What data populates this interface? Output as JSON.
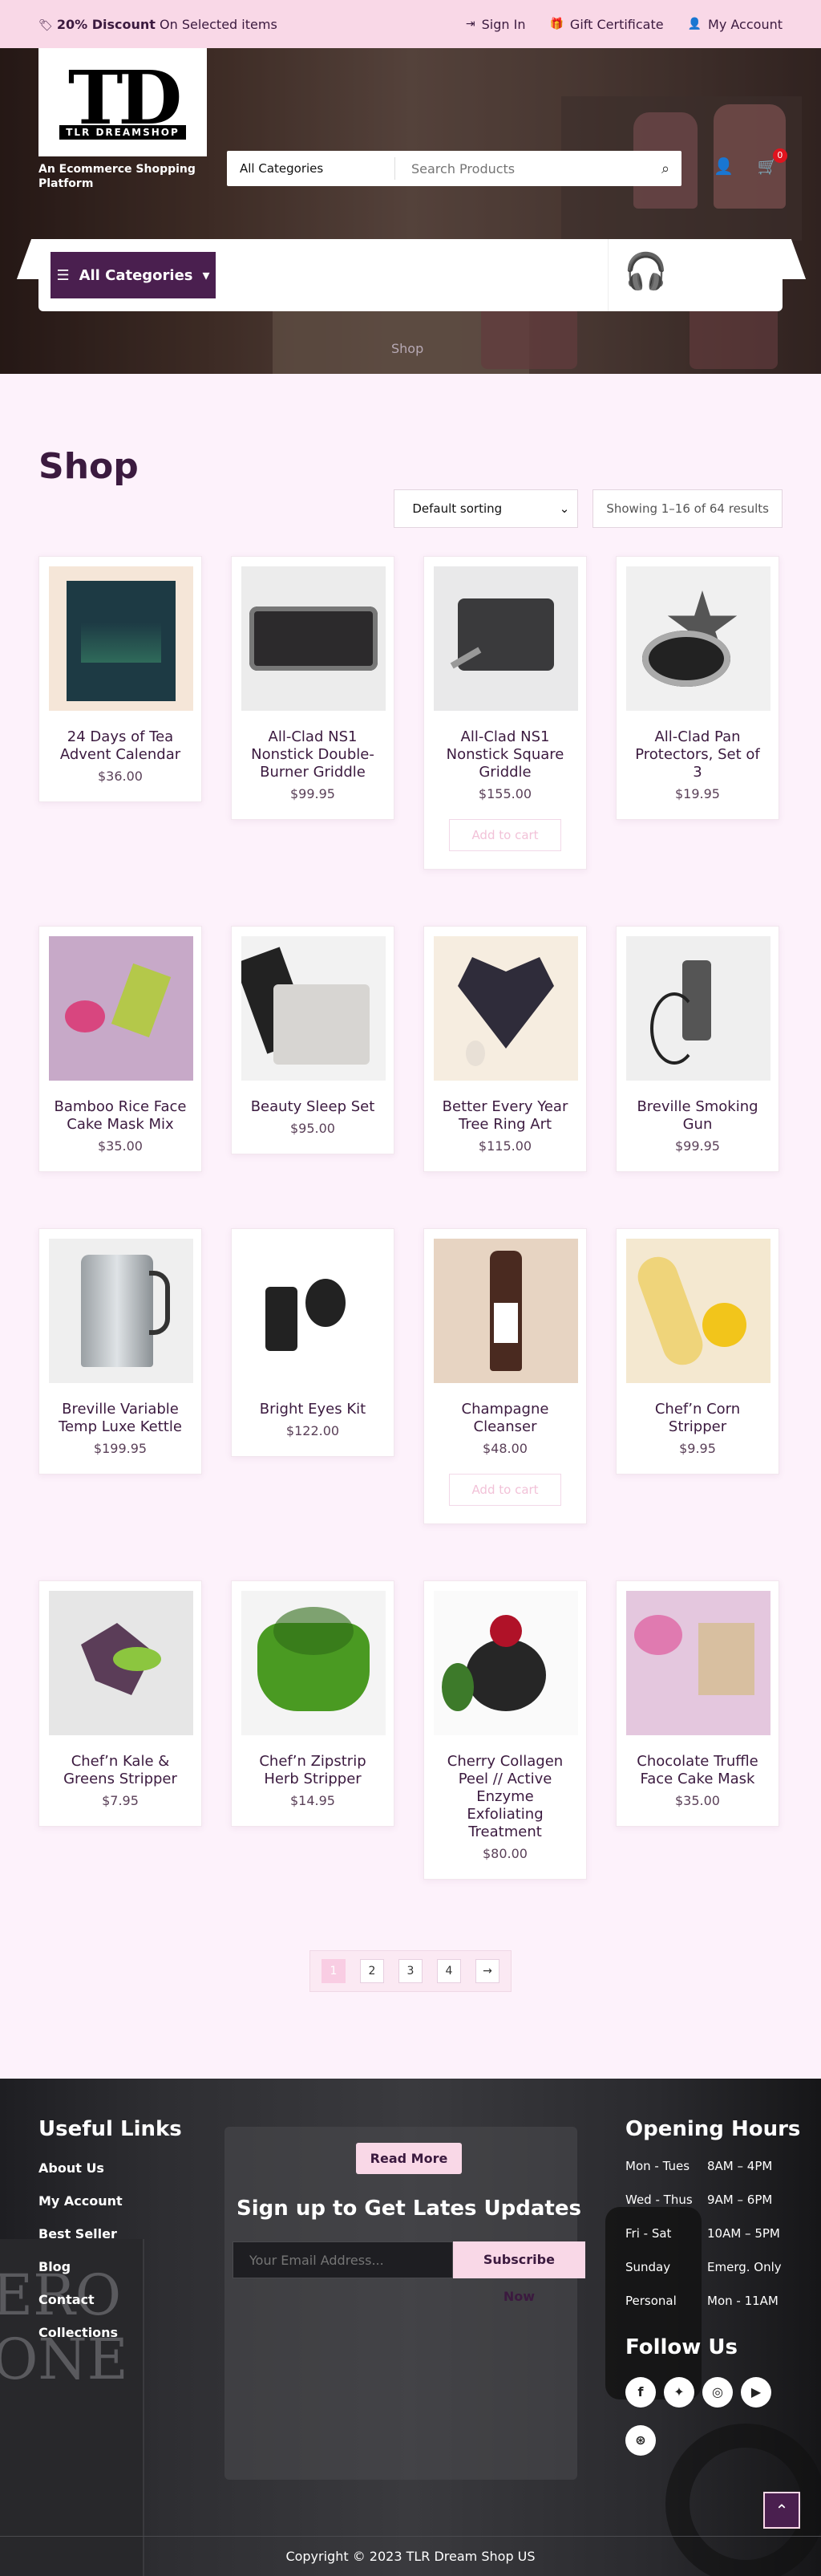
{
  "topbar": {
    "promo_bold": "20% Discount",
    "promo_rest": " On Selected items",
    "signin": "Sign In",
    "gift": "Gift Certificate",
    "account": "My Account"
  },
  "header": {
    "logo_mark": "TD",
    "logo_brand": "TLR DREAMSHOP",
    "tagline": "An Ecommerce Shopping Platform",
    "category_select": "All Categories",
    "search_placeholder": "Search Products",
    "cart_count": "0",
    "all_categories_button": "All Categories",
    "breadcrumb": "Shop"
  },
  "shop": {
    "title": "Shop",
    "sorting": "Default sorting",
    "result_count": "Showing 1–16 of 64 results",
    "add_to_cart": "Add to cart",
    "products": [
      {
        "title": "24 Days of Tea Advent Calendar",
        "price": "$36.00"
      },
      {
        "title": "All-Clad NS1 Nonstick Double-Burner Griddle",
        "price": "$99.95"
      },
      {
        "title": "All-Clad NS1 Nonstick Square Griddle",
        "price": "$155.00",
        "show_cart": true
      },
      {
        "title": "All-Clad Pan Protectors, Set of 3",
        "price": "$19.95"
      },
      {
        "title": "Bamboo Rice Face Cake Mask Mix",
        "price": "$35.00"
      },
      {
        "title": "Beauty Sleep Set",
        "price": "$95.00"
      },
      {
        "title": "Better Every Year Tree Ring Art",
        "price": "$115.00"
      },
      {
        "title": "Breville Smoking Gun",
        "price": "$99.95"
      },
      {
        "title": "Breville Variable Temp Luxe Kettle",
        "price": "$199.95"
      },
      {
        "title": "Bright Eyes Kit",
        "price": "$122.00"
      },
      {
        "title": "Champagne Cleanser",
        "price": "$48.00",
        "show_cart": true
      },
      {
        "title": "Chef’n Corn Stripper",
        "price": "$9.95"
      },
      {
        "title": "Chef’n Kale & Greens Stripper",
        "price": "$7.95"
      },
      {
        "title": "Chef’n Zipstrip Herb Stripper",
        "price": "$14.95"
      },
      {
        "title": "Cherry Collagen Peel // Active Enzyme Exfoliating Treatment",
        "price": "$80.00"
      },
      {
        "title": "Chocolate Truffle Face Cake Mask",
        "price": "$35.00"
      }
    ]
  },
  "pagination": {
    "pages": [
      "1",
      "2",
      "3",
      "4"
    ],
    "next": "→",
    "current": "1"
  },
  "footer": {
    "useful_title": "Useful Links",
    "links": [
      "About Us",
      "My Account",
      "Best Seller",
      "Blog",
      "Contact",
      "Collections"
    ],
    "read_more": "Read More",
    "newsletter_title": "Sign up to Get Lates Updates",
    "email_placeholder": "Your Email Address...",
    "subscribe": "Subscribe Now",
    "hours_title": "Opening Hours",
    "hours": [
      {
        "day": "Mon - Tues",
        "time": "8AM – 4PM"
      },
      {
        "day": "Wed - Thus",
        "time": "9AM – 6PM"
      },
      {
        "day": "Fri - Sat",
        "time": "10AM – 5PM"
      },
      {
        "day": "Sunday",
        "time": "Emerg. Only"
      },
      {
        "day": "Personal",
        "time": "Mon - 11AM"
      }
    ],
    "follow_title": "Follow Us",
    "social_icons": [
      "facebook-icon",
      "twitter-icon",
      "instagram-icon",
      "youtube-icon",
      "dribbble-icon"
    ],
    "copyright": "Copyright © 2023 TLR Dream Shop US"
  },
  "colors": {
    "accent": "#4a1f4f",
    "pink": "#f9d8e7",
    "background": "#fdf2fb",
    "badge": "#e0141e"
  }
}
